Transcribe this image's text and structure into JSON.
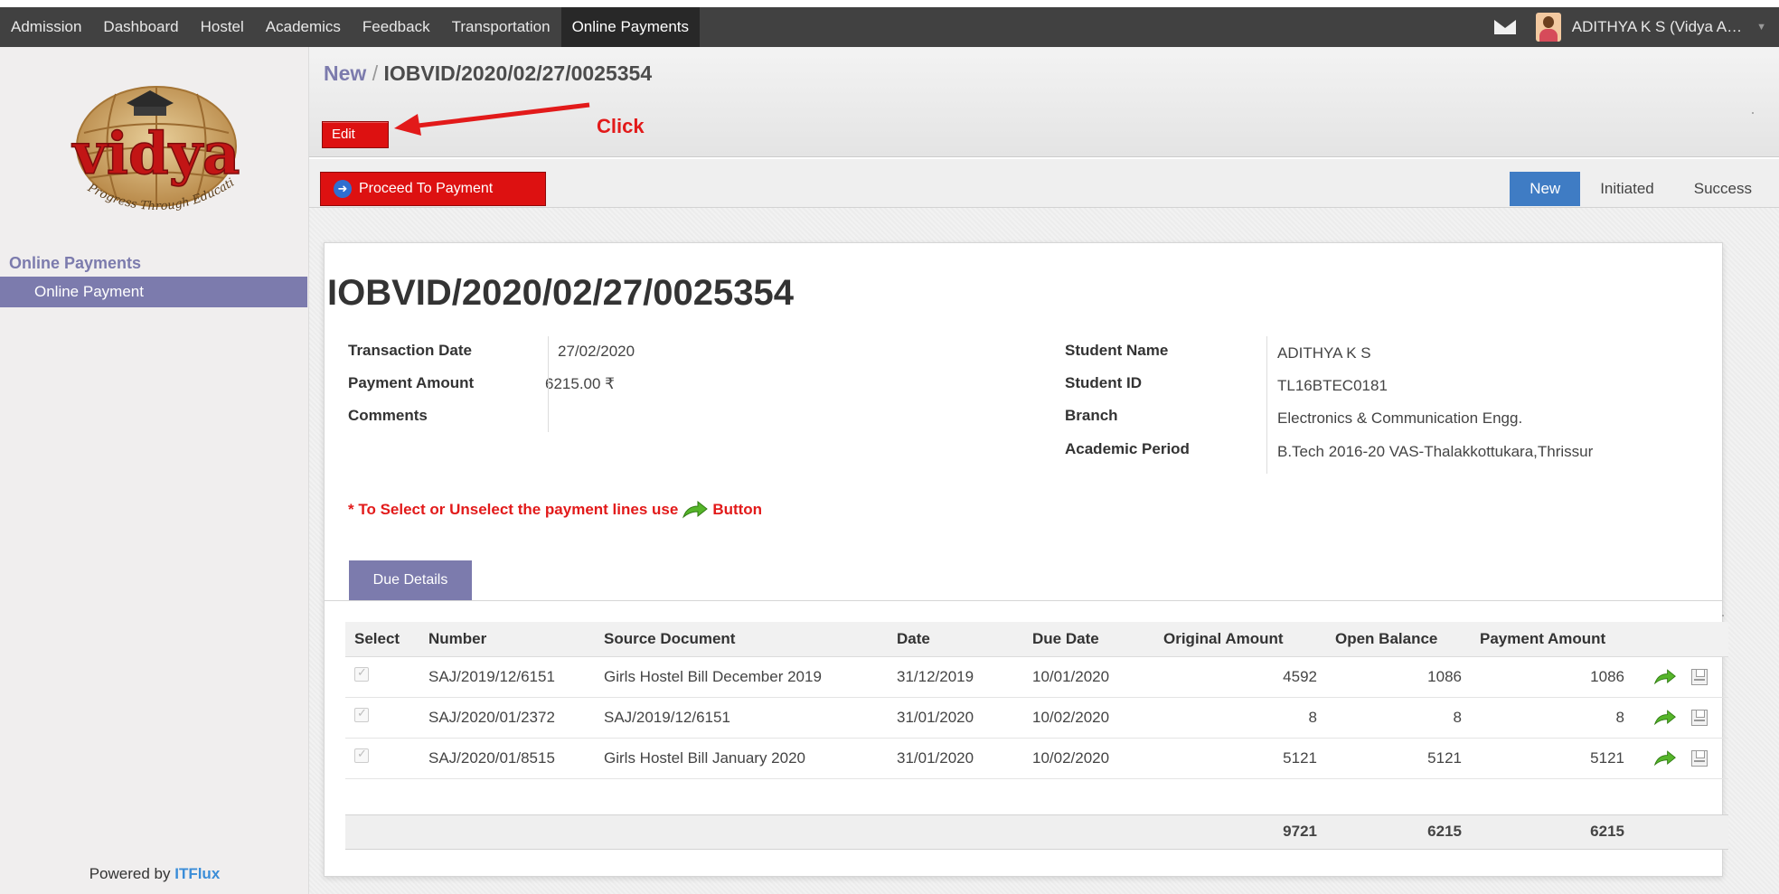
{
  "topnav": {
    "items": [
      {
        "label": "Admission"
      },
      {
        "label": "Dashboard"
      },
      {
        "label": "Hostel"
      },
      {
        "label": "Academics"
      },
      {
        "label": "Feedback"
      },
      {
        "label": "Transportation"
      },
      {
        "label": "Online Payments"
      }
    ],
    "active": "Online Payments",
    "user": "ADITHYA K S (Vidya A…"
  },
  "sidebar": {
    "section": "Online Payments",
    "items": [
      {
        "label": "Online Payment"
      }
    ],
    "powered_prefix": "Powered by",
    "powered_brand": "ITFlux"
  },
  "header": {
    "breadcrumb_parent": "New",
    "breadcrumb_sep": "/",
    "breadcrumb_current": "IOBVID/2020/02/27/0025354",
    "edit_label": "Edit",
    "annotation": "Click"
  },
  "statusbar": {
    "proceed_label": "Proceed To Payment",
    "stages": [
      "New",
      "Initiated",
      "Success"
    ],
    "active_stage": "New"
  },
  "record": {
    "title": "IOBVID/2020/02/27/0025354",
    "left_fields": [
      {
        "label": "Transaction Date",
        "value": "27/02/2020"
      },
      {
        "label": "Payment Amount",
        "value": "6215.00 ₹"
      },
      {
        "label": "Comments",
        "value": ""
      }
    ],
    "right_fields": [
      {
        "label": "Student Name",
        "value": "ADITHYA K S"
      },
      {
        "label": "Student ID",
        "value": "TL16BTEC0181"
      },
      {
        "label": "Branch",
        "value": "Electronics & Communication Engg."
      },
      {
        "label": "Academic Period",
        "value": "B.Tech 2016-20 VAS-Thalakkottukara,Thrissur"
      }
    ],
    "note_prefix": "* To Select or Unselect the payment lines use",
    "note_suffix": "Button"
  },
  "tab": {
    "label": "Due Details"
  },
  "table": {
    "headers": [
      "Select",
      "Number",
      "Source Document",
      "Date",
      "Due Date",
      "Original Amount",
      "Open Balance",
      "Payment Amount"
    ],
    "rows": [
      {
        "number": "SAJ/2019/12/6151",
        "source": "Girls Hostel Bill December 2019",
        "date": "31/12/2019",
        "due": "10/01/2020",
        "original": "4592",
        "open": "1086",
        "payment": "1086"
      },
      {
        "number": "SAJ/2020/01/2372",
        "source": "SAJ/2019/12/6151",
        "date": "31/01/2020",
        "due": "10/02/2020",
        "original": "8",
        "open": "8",
        "payment": "8"
      },
      {
        "number": "SAJ/2020/01/8515",
        "source": "Girls Hostel Bill January 2020",
        "date": "31/01/2020",
        "due": "10/02/2020",
        "original": "5121",
        "open": "5121",
        "payment": "5121"
      }
    ],
    "totals": {
      "original": "9721",
      "open": "6215",
      "payment": "6215"
    }
  },
  "colors": {
    "accent": "#7c7bad",
    "danger": "#dd1111",
    "stage_active": "#3f7cc4",
    "annotation": "#e21a1a"
  }
}
